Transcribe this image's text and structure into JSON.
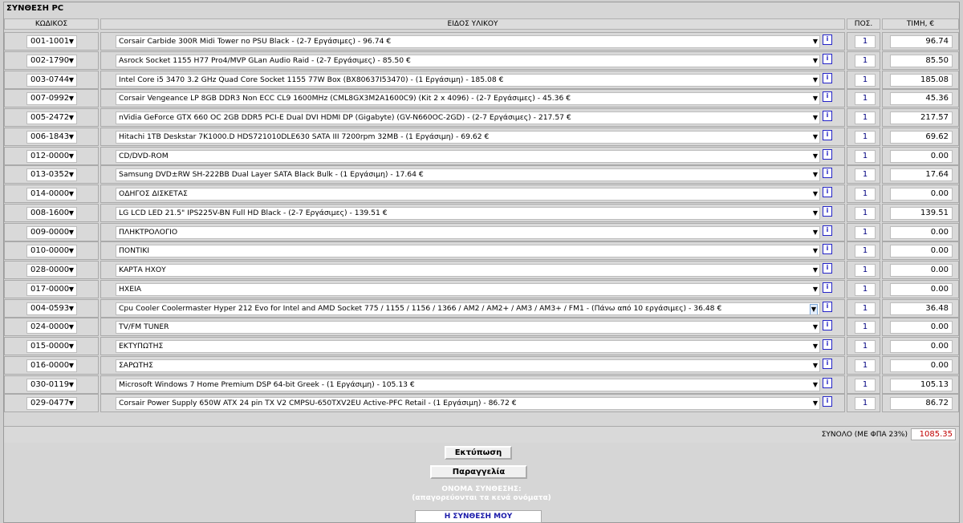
{
  "window_title": "ΣΥΝΘΕΣΗ PC",
  "headers": {
    "code": "ΚΩΔΙΚΟΣ",
    "desc": "ΕΙΔΟΣ ΥΛΙΚΟΥ",
    "qty": "ΠΟΣ.",
    "price": "ΤΙΜΗ, €"
  },
  "info_glyph": "i",
  "rows": [
    {
      "code": "001-1001",
      "desc": "Corsair Carbide 300R Midi Tower no PSU Black - (2-7 Εργάσιμες) - 96.74 €",
      "qty": "1",
      "price": "96.74"
    },
    {
      "code": "002-1790",
      "desc": "Asrock Socket 1155 H77 Pro4/MVP GLan Audio Raid - (2-7 Εργάσιμες) - 85.50 €",
      "qty": "1",
      "price": "85.50"
    },
    {
      "code": "003-0744",
      "desc": "Intel Core i5 3470 3.2 GHz Quad Core Socket 1155 77W Box (BX80637I53470) - (1 Εργάσιμη) - 185.08 €",
      "qty": "1",
      "price": "185.08"
    },
    {
      "code": "007-0992",
      "desc": "Corsair Vengeance LP 8GB DDR3 Non ECC CL9 1600MHz (CML8GX3M2A1600C9) (Kit 2 x 4096) - (2-7 Εργάσιμες) - 45.36 €",
      "qty": "1",
      "price": "45.36"
    },
    {
      "code": "005-2472",
      "desc": "nVidia GeForce GTX 660 OC 2GB DDR5 PCI-E Dual DVI HDMI DP (Gigabyte) (GV-N660OC-2GD) - (2-7 Εργάσιμες) - 217.57 €",
      "qty": "1",
      "price": "217.57"
    },
    {
      "code": "006-1843",
      "desc": "Hitachi 1TB Deskstar 7K1000.D HDS721010DLE630 SATA III 7200rpm 32MB - (1 Εργάσιμη) - 69.62 €",
      "qty": "1",
      "price": "69.62"
    },
    {
      "code": "012-0000",
      "desc": "CD/DVD-ROM",
      "qty": "1",
      "price": "0.00"
    },
    {
      "code": "013-0352",
      "desc": "Samsung DVD±RW SH-222BB Dual Layer SATA Black Bulk - (1 Εργάσιμη) - 17.64 €",
      "qty": "1",
      "price": "17.64"
    },
    {
      "code": "014-0000",
      "desc": "ΟΔΗΓΟΣ ΔΙΣΚΕΤΑΣ",
      "qty": "1",
      "price": "0.00"
    },
    {
      "code": "008-1600",
      "desc": "LG LCD LED 21.5\" IPS225V-BN Full HD Black - (2-7 Εργάσιμες) - 139.51 €",
      "qty": "1",
      "price": "139.51"
    },
    {
      "code": "009-0000",
      "desc": "ΠΛΗΚΤΡΟΛΟΓΙΟ",
      "qty": "1",
      "price": "0.00"
    },
    {
      "code": "010-0000",
      "desc": "ΠΟΝΤΙΚΙ",
      "qty": "1",
      "price": "0.00"
    },
    {
      "code": "028-0000",
      "desc": "ΚΑΡΤΑ ΗΧΟΥ",
      "qty": "1",
      "price": "0.00"
    },
    {
      "code": "017-0000",
      "desc": "ΗΧΕΙΑ",
      "qty": "1",
      "price": "0.00"
    },
    {
      "code": "004-0593",
      "desc": "Cpu Cooler Coolermaster Hyper 212 Evo for Intel and AMD Socket 775 / 1155 / 1156 / 1366 / AM2 / AM2+ / AM3 / AM3+ / FM1 - (Πάνω από 10 εργάσιμες) - 36.48 €",
      "qty": "1",
      "price": "36.48"
    },
    {
      "code": "024-0000",
      "desc": "TV/FM TUNER",
      "qty": "1",
      "price": "0.00"
    },
    {
      "code": "015-0000",
      "desc": "ΕΚΤΥΠΩΤΗΣ",
      "qty": "1",
      "price": "0.00"
    },
    {
      "code": "016-0000",
      "desc": "ΣΑΡΩΤΗΣ",
      "qty": "1",
      "price": "0.00"
    },
    {
      "code": "030-0119",
      "desc": "Microsoft Windows 7 Home Premium DSP 64-bit Greek - (1 Εργάσιμη) - 105.13 €",
      "qty": "1",
      "price": "105.13"
    },
    {
      "code": "029-0477",
      "desc": "Corsair Power Supply 650W ATX 24 pin TX V2 CMPSU-650TXV2EU Active-PFC Retail - (1 Εργάσιμη) - 86.72 €",
      "qty": "1",
      "price": "86.72"
    }
  ],
  "total": {
    "label": "ΣΥΝΟΛΟ (ΜΕ ΦΠΑ 23%)",
    "value": "1085.35"
  },
  "buttons": {
    "print": "Εκτύπωση",
    "order": "Παραγγελία"
  },
  "name_label": {
    "line1": "ΟΝΟΜΑ ΣΥΝΘΕΣΗΣ:",
    "line2": "(απαγορεύονται τα κενά ονόματα)"
  },
  "name_value": "Η ΣΥΝΘΕΣΗ ΜΟΥ",
  "colors": {
    "info_blue": "#2424c8",
    "total_red": "#c00000",
    "name_blue": "#1a1aaa"
  }
}
